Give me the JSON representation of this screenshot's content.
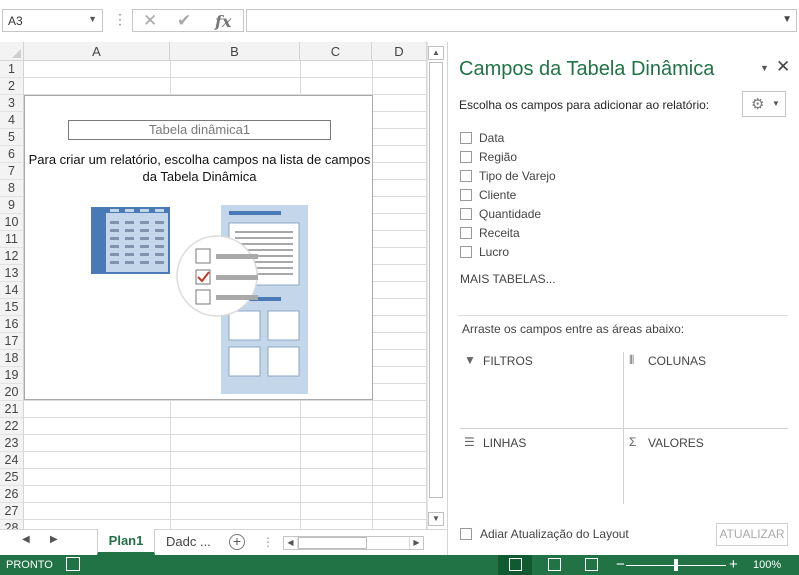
{
  "formula_bar": {
    "name_box": "A3",
    "cancel_icon": "✕",
    "enter_icon": "✔",
    "fx_label": "fx",
    "formula_value": ""
  },
  "sheet": {
    "columns": [
      "A",
      "B",
      "C",
      "D"
    ],
    "rows": [
      "1",
      "2",
      "3",
      "4",
      "5",
      "6",
      "7",
      "8",
      "9",
      "10",
      "11",
      "12",
      "13",
      "14",
      "15",
      "16",
      "17",
      "18",
      "19",
      "20",
      "21",
      "22",
      "23",
      "24",
      "25",
      "26",
      "27",
      "28"
    ]
  },
  "pivot_placeholder": {
    "name": "Tabela dinâmica1",
    "message": "Para criar um relatório, escolha campos na lista de campos da Tabela Dinâmica"
  },
  "tabs": {
    "active": "Plan1",
    "other": "Dadc ...",
    "add_label": "+"
  },
  "pane": {
    "title": "Campos da Tabela Dinâmica",
    "subtitle": "Escolha os campos para adicionar ao relatório:",
    "fields": [
      "Data",
      "Região",
      "Tipo de Varejo",
      "Cliente",
      "Quantidade",
      "Receita",
      "Lucro"
    ],
    "more_tables": "MAIS TABELAS...",
    "drag_label": "Arraste os campos entre as áreas abaixo:",
    "areas": {
      "filters": "FILTROS",
      "columns": "COLUNAS",
      "rows": "LINHAS",
      "values": "VALORES"
    },
    "defer_label": "Adiar Atualização do Layout",
    "update_button": "ATUALIZAR"
  },
  "status_bar": {
    "status": "PRONTO",
    "zoom": "100%",
    "zoom_fraction": 0.5
  },
  "colors": {
    "excel_green": "#217346",
    "pivot_blue": "#4a7ab5",
    "pivot_light_blue": "#c3d6ea",
    "check_red": "#c0392b"
  }
}
